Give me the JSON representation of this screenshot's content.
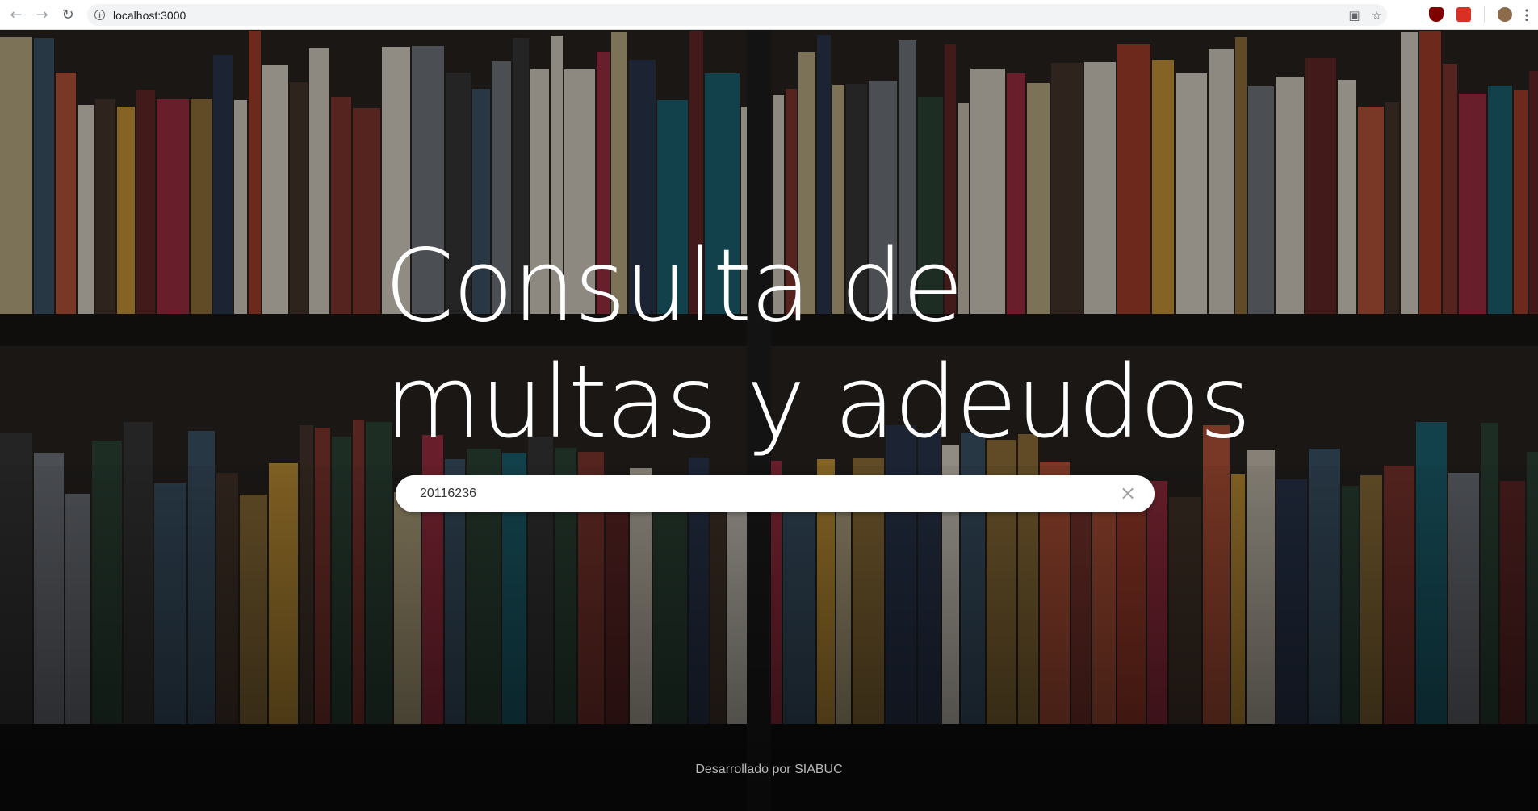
{
  "browser": {
    "url": "localhost:3000",
    "icons": [
      "back-icon",
      "forward-icon",
      "reload-icon",
      "site-info-icon",
      "translate-icon",
      "bookmark-star-icon"
    ]
  },
  "hero": {
    "title_line1": "Consulta de",
    "title_line2": "multas y adeudos"
  },
  "search": {
    "value": "20116236"
  },
  "footer": {
    "text": "Desarrollado por SIABUC"
  }
}
